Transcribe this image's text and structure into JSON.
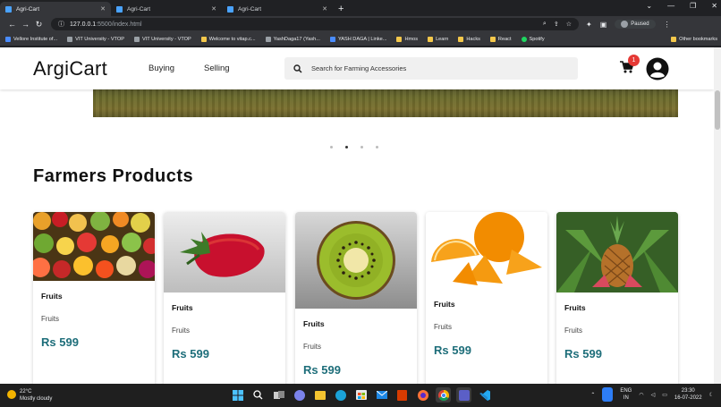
{
  "browser": {
    "tabs": [
      {
        "title": "Agri-Cart",
        "active": true
      },
      {
        "title": "Agri-Cart",
        "active": false
      },
      {
        "title": "Agri-Cart",
        "active": false
      }
    ],
    "url_host": "127.0.0.1",
    "url_path": ":5500/index.html",
    "profile_status": "Paused",
    "bookmarks": [
      {
        "label": "Vellore Institute of...",
        "icon": "blue"
      },
      {
        "label": "VIT University - VTOP",
        "icon": "gray"
      },
      {
        "label": "VIT University - VTOP",
        "icon": "gray"
      },
      {
        "label": "Welcome to vitap.c...",
        "icon": "yellow"
      },
      {
        "label": "YashDaga17 (Yash...",
        "icon": "gray"
      },
      {
        "label": "YASH DAGA | Linke...",
        "icon": "blue"
      },
      {
        "label": "Hmos",
        "icon": "yellow"
      },
      {
        "label": "Learn",
        "icon": "yellow"
      },
      {
        "label": "Hacks",
        "icon": "yellow"
      },
      {
        "label": "React",
        "icon": "yellow"
      },
      {
        "label": "Spotify",
        "icon": "green"
      }
    ],
    "other_bookmarks": "Other bookmarks"
  },
  "site": {
    "logo_main": "Argi",
    "logo_rest": "Cart",
    "nav": [
      "Buying",
      "Selling"
    ],
    "search_placeholder": "Search for Farming Accessories",
    "cart_count": "1",
    "section_title": "Farmers Products",
    "carousel_active_index": 1,
    "carousel_count": 4
  },
  "products": [
    {
      "name": "Fruits",
      "category": "Fruits",
      "price": "Rs 599",
      "image": "mixed-fruits"
    },
    {
      "name": "Fruits",
      "category": "Fruits",
      "price": "Rs 599",
      "image": "strawberry"
    },
    {
      "name": "Fruits",
      "category": "Fruits",
      "price": "Rs 599",
      "image": "kiwi"
    },
    {
      "name": "Fruits",
      "category": "Fruits",
      "price": "Rs 599",
      "image": "orange"
    },
    {
      "name": "Fruits",
      "category": "Fruits",
      "price": "Rs 599",
      "image": "pineapple"
    }
  ],
  "taskbar": {
    "temperature": "22°C",
    "weather": "Mostly cloudy",
    "lang1": "ENG",
    "lang2": "IN",
    "time": "23:30",
    "date": "16-07-2022"
  }
}
